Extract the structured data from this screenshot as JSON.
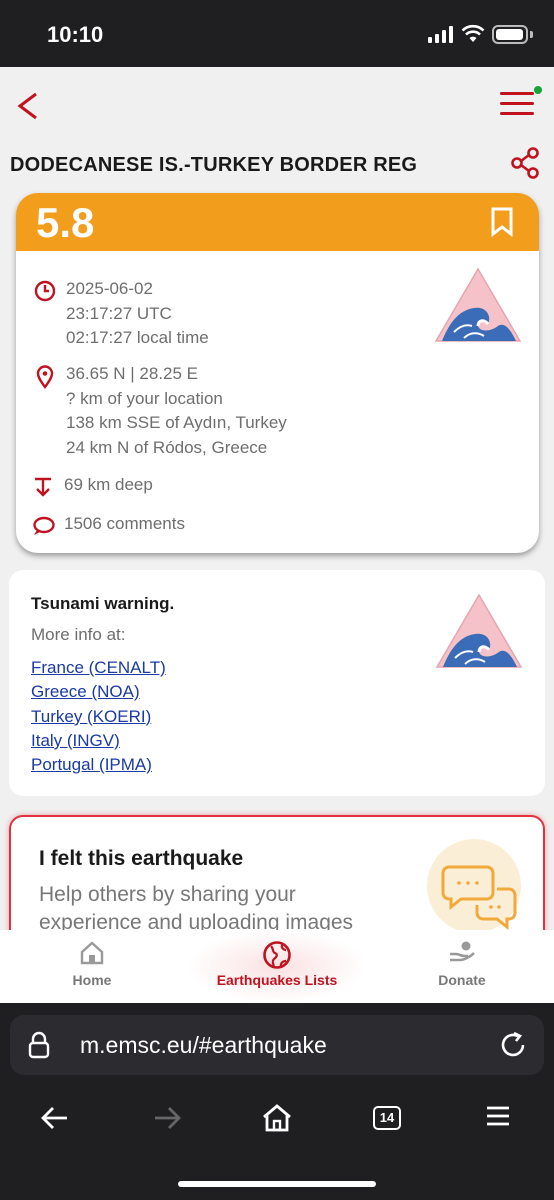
{
  "status_bar": {
    "time": "10:10"
  },
  "header": {
    "title": "DODECANESE IS.-TURKEY BORDER REG"
  },
  "quake": {
    "magnitude": "5.8",
    "date": "2025-06-02",
    "utc_time": "23:17:27 UTC",
    "local_time": "02:17:27 local time",
    "coordinates": "36.65 N | 28.25 E",
    "distance_you": "? km of your location",
    "distance_1": "138 km SSE of Aydın, Turkey",
    "distance_2": "24 km N of Ródos, Greece",
    "depth": "69 km deep",
    "comments": "1506  comments"
  },
  "tsunami": {
    "title": "Tsunami warning.",
    "more_info": "More info at:",
    "links": [
      "France (CENALT)",
      "Greece (NOA)",
      "Turkey (KOERI)",
      "Italy (INGV)",
      "Portugal (IPMA)"
    ]
  },
  "felt": {
    "title": "I felt this earthquake",
    "subtitle": "Help others by sharing your experience and uploading images"
  },
  "bottom_nav": {
    "home": "Home",
    "lists": "Earthquakes Lists",
    "donate": "Donate"
  },
  "browser": {
    "url": "m.emsc.eu/#earthquake",
    "tab_count": "14"
  },
  "colors": {
    "accent": "#c1121f",
    "magnitude_bg": "#f29d1c",
    "link": "#1a3aa5"
  },
  "icons": [
    "back-icon",
    "menu-icon",
    "share-icon",
    "bookmark-icon",
    "clock-icon",
    "location-pin-icon",
    "depth-icon",
    "comment-icon",
    "tsunami-logo-icon",
    "chat-bubbles-icon",
    "home-icon",
    "globe-icon",
    "donate-icon",
    "lock-icon",
    "reload-icon",
    "arrow-back-icon",
    "arrow-forward-icon",
    "browser-home-icon",
    "tabs-icon",
    "browser-menu-icon"
  ]
}
